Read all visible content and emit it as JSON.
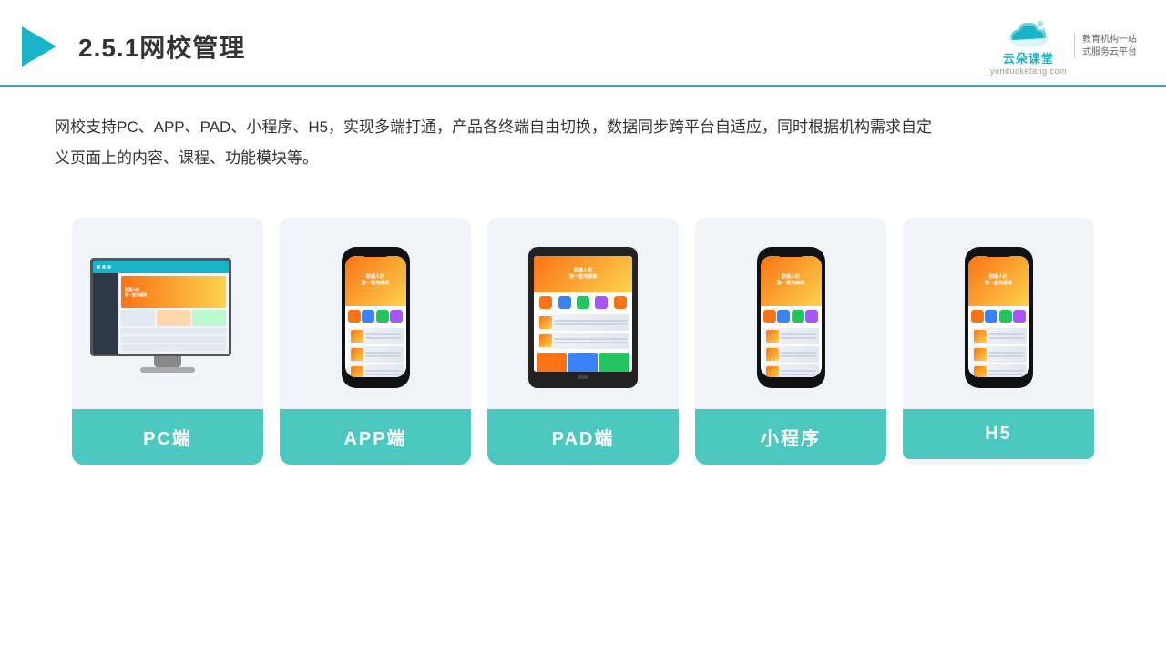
{
  "header": {
    "title": "2.5.1网校管理",
    "logo_main": "云朵课堂",
    "logo_sub": "yunduoketang.com",
    "logo_slogan_line1": "教育机构一站",
    "logo_slogan_line2": "式服务云平台"
  },
  "description": {
    "text": "网校支持PC、APP、PAD、小程序、H5，实现多端打通，产品各终端自由切换，数据同步跨平台自适应，同时根据机构需求自定义页面上的内容、课程、功能模块等。"
  },
  "cards": [
    {
      "label": "PC端",
      "device": "pc"
    },
    {
      "label": "APP端",
      "device": "phone"
    },
    {
      "label": "PAD端",
      "device": "tablet"
    },
    {
      "label": "小程序",
      "device": "phone"
    },
    {
      "label": "H5",
      "device": "phone"
    }
  ]
}
